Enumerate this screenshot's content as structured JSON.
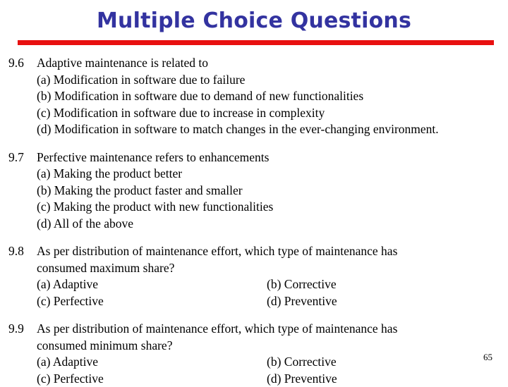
{
  "slide": {
    "title": "Multiple Choice Questions",
    "accent_color": "#3333a0",
    "rule_color": "#e81010",
    "page_number": "65"
  },
  "questions": [
    {
      "number": "9.6",
      "stem": "Adaptive maintenance is related to",
      "stem_wrap": "",
      "layout": "single",
      "options": [
        "(a) Modification in software due to failure",
        "(b) Modification in software due to demand of new functionalities",
        "(c) Modification in software due to increase in complexity",
        "(d) Modification in software to match changes in the ever-changing environment."
      ]
    },
    {
      "number": "9.7",
      "stem": "Perfective maintenance refers to enhancements",
      "stem_wrap": "",
      "layout": "single",
      "options": [
        "(a) Making the product better",
        "(b) Making the product faster and smaller",
        "(c) Making the product with new functionalities",
        "(d) All of the above"
      ]
    },
    {
      "number": "9.8",
      "stem": "As per distribution of maintenance effort, which type of maintenance has",
      "stem_wrap": "consumed maximum share?",
      "layout": "two-column",
      "options": [
        "(a) Adaptive",
        "(b) Corrective",
        "(c) Perfective",
        "(d) Preventive"
      ]
    },
    {
      "number": "9.9",
      "stem": "As per distribution of maintenance effort, which type of maintenance has",
      "stem_wrap": "consumed minimum share?",
      "layout": "two-column",
      "options": [
        "(a) Adaptive",
        "(b) Corrective",
        "(c) Perfective",
        "(d) Preventive"
      ]
    }
  ]
}
